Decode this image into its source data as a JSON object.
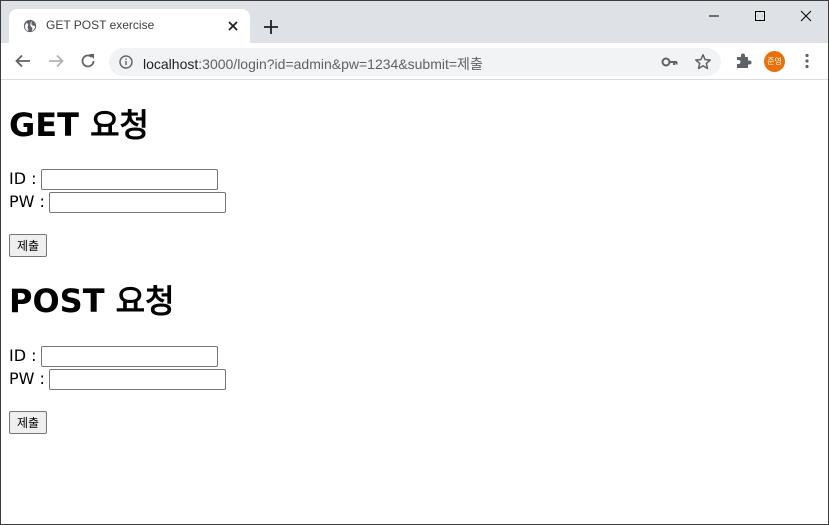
{
  "browser": {
    "tab_title": "GET POST exercise",
    "url_host": "localhost",
    "url_path": ":3000/login?id=admin&pw=1234&submit=제출",
    "profile_label": "준영",
    "icons": {
      "favicon": "globe-icon",
      "close": "close-icon",
      "new_tab": "plus-icon",
      "back": "back-arrow-icon",
      "forward": "forward-arrow-icon",
      "reload": "reload-icon",
      "site_info": "info-icon",
      "passwords": "key-icon",
      "bookmark": "star-icon",
      "extensions": "puzzle-icon",
      "menu": "kebab-menu-icon"
    },
    "colors": {
      "tab_strip": "#dee1e6",
      "omnibox": "#f1f3f4",
      "avatar": "#e8710a"
    }
  },
  "page": {
    "get_form": {
      "heading": "GET 요청",
      "id_label": "ID :",
      "id_value": "",
      "pw_label": "PW :",
      "pw_value": "",
      "submit_label": "제출"
    },
    "post_form": {
      "heading": "POST 요청",
      "id_label": "ID :",
      "id_value": "",
      "pw_label": "PW :",
      "pw_value": "",
      "submit_label": "제출"
    }
  }
}
